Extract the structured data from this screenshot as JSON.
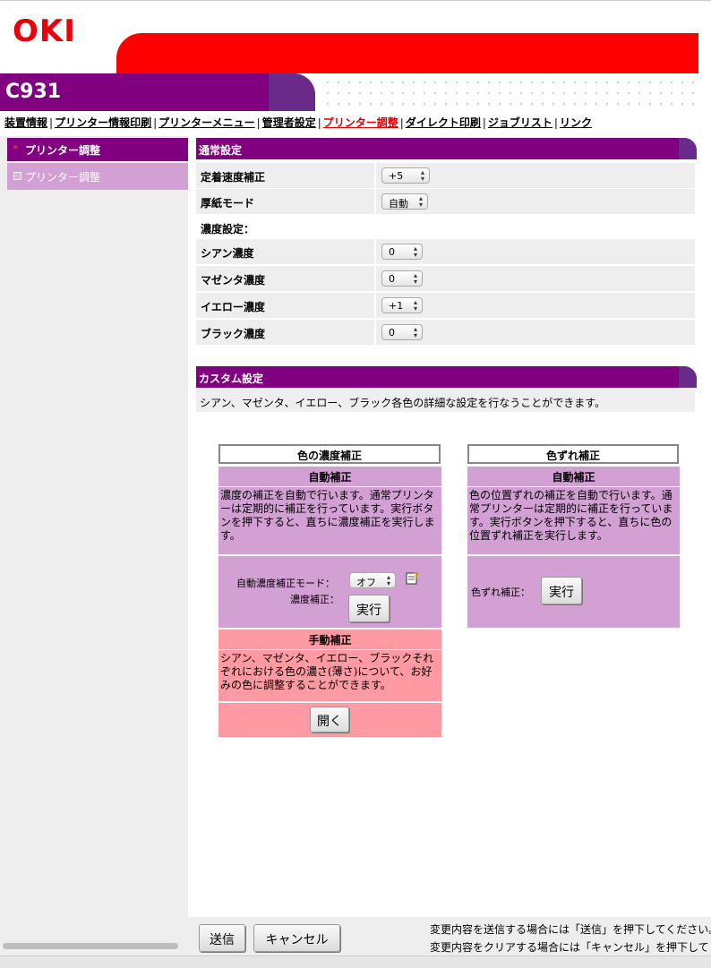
{
  "brand": {
    "logo": "OKI",
    "model": "C931",
    "brand_red": "#ff0000",
    "brand_purple": "#800080"
  },
  "nav": [
    {
      "label": "装置情報",
      "active": false
    },
    {
      "label": "プリンター情報印刷",
      "active": false
    },
    {
      "label": "プリンターメニュー",
      "active": false
    },
    {
      "label": "管理者設定",
      "active": false
    },
    {
      "label": "プリンター調整",
      "active": true
    },
    {
      "label": "ダイレクト印刷",
      "active": false
    },
    {
      "label": "ジョブリスト",
      "active": false
    },
    {
      "label": "リンク",
      "active": false
    }
  ],
  "nav_separator": "|",
  "sidebar": {
    "header": "プリンター調整",
    "items": [
      {
        "label": "プリンター調整"
      }
    ]
  },
  "general": {
    "title": "通常設定",
    "rows": [
      {
        "label": "定着速度補正",
        "value": "+5"
      },
      {
        "label": "厚紙モード",
        "value": "自動"
      }
    ],
    "density_heading": "濃度設定：",
    "density_rows": [
      {
        "label": "シアン濃度",
        "value": "0"
      },
      {
        "label": "マゼンタ濃度",
        "value": "0"
      },
      {
        "label": "イエロー濃度",
        "value": "+1"
      },
      {
        "label": "ブラック濃度",
        "value": "0"
      }
    ]
  },
  "custom": {
    "title": "カスタム設定",
    "description": "シアン、マゼンタ、イエロー、ブラック各色の詳細な設定を行なうことができます。",
    "density_box": {
      "title": "色の濃度補正",
      "auto_title": "自動補正",
      "auto_desc": "濃度の補正を自動で行います。通常プリンターは定期的に補正を行っています。実行ボタンを押下すると、直ちに濃度補正を実行します。",
      "mode_label": "自動濃度補正モード：",
      "mode_value": "オフ",
      "run_label": "濃度補正：",
      "run_button": "実行",
      "manual_title": "手動補正",
      "manual_desc": "シアン、マゼンタ、イエロー、ブラックそれぞれにおける色の濃さ(薄さ)について、お好みの色に調整することができます。",
      "open_button": "開く"
    },
    "registration_box": {
      "title": "色ずれ補正",
      "auto_title": "自動補正",
      "auto_desc": "色の位置ずれの補正を自動で行います。通常プリンターは定期的に補正を行っています。実行ボタンを押下すると、直ちに色の位置ずれ補正を実行します。",
      "run_label": "色ずれ補正：",
      "run_button": "実行"
    }
  },
  "footer": {
    "submit_button": "送信",
    "cancel_button": "キャンセル",
    "note_submit": "変更内容を送信する場合には「送信」を押下してください。",
    "note_cancel": "変更内容をクリアする場合には「キャンセル」を押下して"
  }
}
